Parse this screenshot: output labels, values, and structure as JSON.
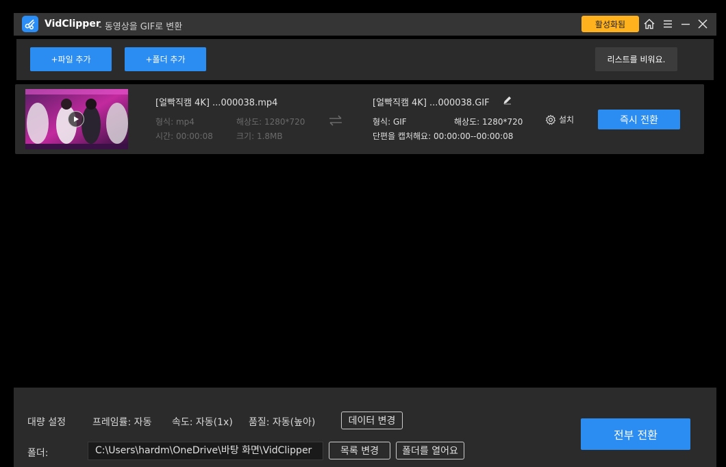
{
  "titlebar": {
    "app_name": "VidClipper",
    "subtitle": "- 동영상을 GIF로 변환",
    "activate_label": "활성화됨",
    "icons": [
      "home-icon",
      "menu-icon",
      "minimize-icon",
      "close-icon"
    ]
  },
  "toolbar": {
    "add_file_label": "+파일 추가",
    "add_folder_label": "+폴더 추가",
    "clear_list_label": "리스트를 비워요."
  },
  "file": {
    "source_name": "[얼빡직캠 4K] ...000038.mp4",
    "source_format": "형식: mp4",
    "source_resolution": "해상도: 1280*720",
    "source_duration": "시간: 00:00:08",
    "source_size": "크기: 1.8MB",
    "output_name": "[얼빡직캠 4K] ...000038.GIF",
    "output_format": "형식: GIF",
    "output_resolution": "해상도: 1280*720",
    "output_clip": "단편을 캡처해요: 00:00:00--00:00:08",
    "settings_label": "설치",
    "convert_now_label": "즉시 전환"
  },
  "bottom": {
    "batch_label": "대량 설정",
    "framerate": "프레임률: 자동",
    "speed": "속도: 자동(1x)",
    "quality": "품질: 자동(높아)",
    "change_data_label": "데이터 변경",
    "folder_label": "폴더:",
    "folder_path": "C:\\Users\\hardm\\OneDrive\\바탕 화면\\VidClipper",
    "change_dir_label": "목록 변경",
    "open_folder_label": "폴더를 열어요",
    "convert_all_label": "전부 전환"
  },
  "colors": {
    "accent": "#2b8cf2",
    "activate": "#ffb21e",
    "panel": "#2b2b2b",
    "titlebar": "#353535"
  }
}
